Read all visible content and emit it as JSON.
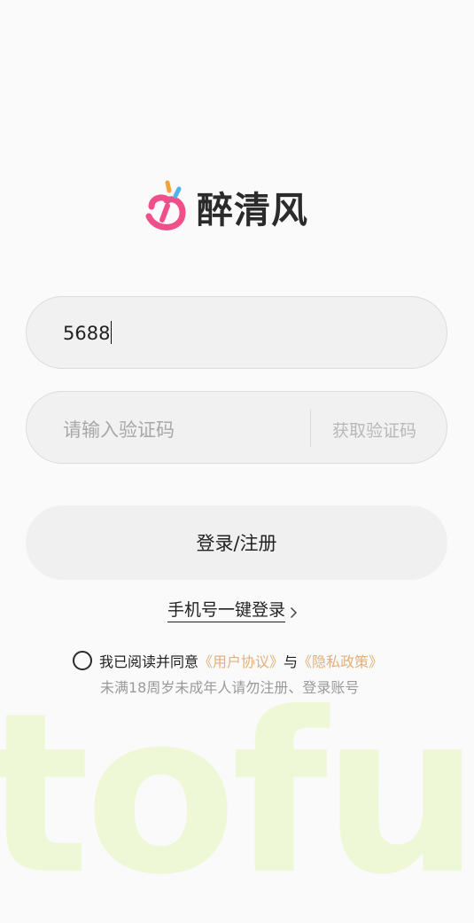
{
  "app": {
    "name": "醉清风",
    "watermark": "tofu"
  },
  "phone_field": {
    "value": "5688"
  },
  "code_field": {
    "placeholder": "请输入验证码",
    "get_code_label": "获取验证码"
  },
  "login_button": {
    "label": "登录/注册"
  },
  "quick_login": {
    "label": "手机号一键登录"
  },
  "agreement": {
    "checked": false,
    "prefix": "我已阅读并同意",
    "user_agreement": "《用户协议》",
    "conjunction": "与",
    "privacy_policy": "《隐私政策》",
    "notice": "未满18周岁未成年人请勿注册、登录账号"
  },
  "colors": {
    "logo_pink": "#f0508a",
    "logo_orange": "#f5a23a",
    "logo_blue": "#4fb5ec",
    "link": "#e3b07a",
    "watermark": "#eef8d6"
  },
  "icons": {
    "logo": "brand-logo-icon",
    "chevron": "chevron-right-icon",
    "radio": "radio-unchecked-icon"
  }
}
